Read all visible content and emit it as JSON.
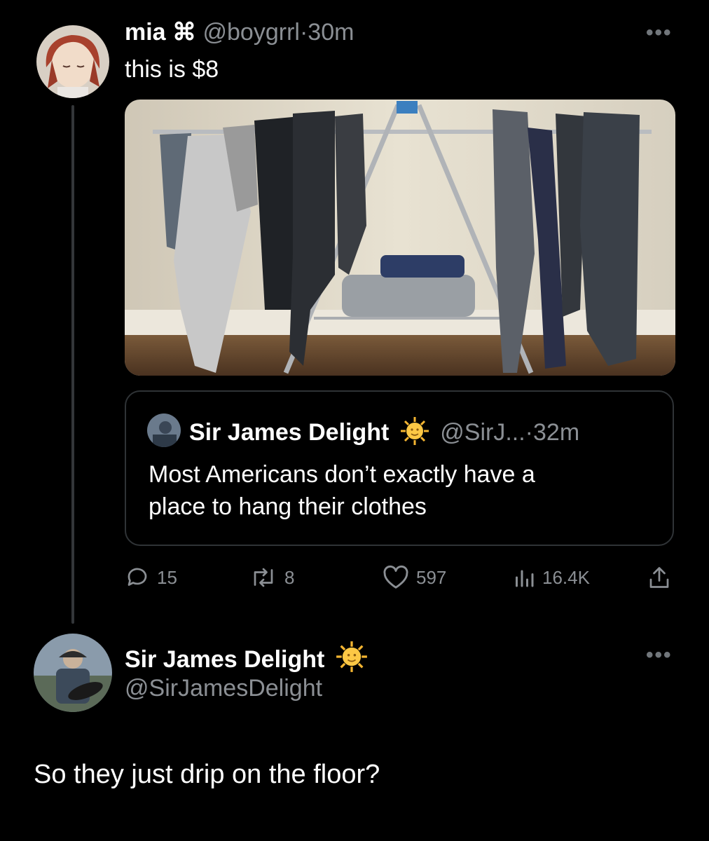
{
  "tweet": {
    "display_name": "mia",
    "name_symbol": "⌘",
    "handle": "@boygrrl",
    "separator": "·",
    "time": "30m",
    "text": "this is $8",
    "more_label": "•••"
  },
  "quote": {
    "display_name": "Sir James Delight",
    "badge_icon": "sun-face-emoji",
    "handle": "@SirJ...",
    "separator": "·",
    "time": "32m",
    "text_line1": "Most Americans don’t exactly have a",
    "text_line2": "place to hang their clothes"
  },
  "actions": {
    "replies": "15",
    "retweets": "8",
    "likes": "597",
    "views": "16.4K"
  },
  "reply": {
    "display_name": "Sir James Delight",
    "badge_icon": "sun-face-emoji",
    "handle": "@SirJamesDelight",
    "text": "So they just drip on the floor?",
    "more_label": "•••"
  },
  "colors": {
    "background": "#000000",
    "text": "#e7e9ea",
    "muted": "#8b8f94",
    "border": "#2f3336"
  }
}
